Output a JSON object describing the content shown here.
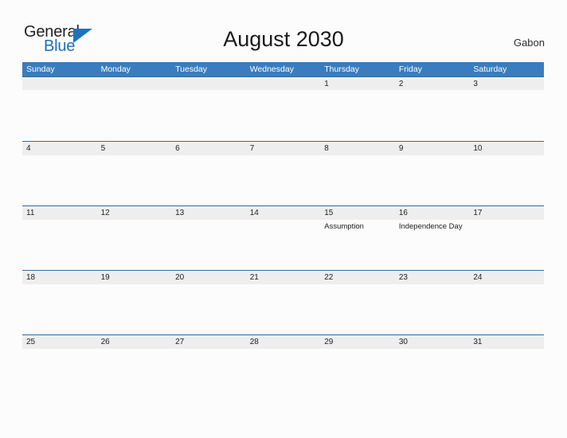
{
  "brand": {
    "name_part1": "General",
    "name_part2": "Blue",
    "triangle_color": "#2072b8"
  },
  "header": {
    "title": "August 2030",
    "country": "Gabon"
  },
  "colors": {
    "header_blue": "#3a7cbd",
    "row_divider_blue": "#2e6da4",
    "date_band_gray": "#eeeeee",
    "page_background": "#fcfcfc",
    "brand_blue": "#1e6fbd"
  },
  "calendar": {
    "month": "August",
    "year": "2030",
    "weekdays": [
      "Sunday",
      "Monday",
      "Tuesday",
      "Wednesday",
      "Thursday",
      "Friday",
      "Saturday"
    ],
    "weeks": [
      {
        "days": [
          {
            "date": "",
            "event": ""
          },
          {
            "date": "",
            "event": ""
          },
          {
            "date": "",
            "event": ""
          },
          {
            "date": "",
            "event": ""
          },
          {
            "date": "1",
            "event": ""
          },
          {
            "date": "2",
            "event": ""
          },
          {
            "date": "3",
            "event": ""
          }
        ]
      },
      {
        "days": [
          {
            "date": "4",
            "event": ""
          },
          {
            "date": "5",
            "event": ""
          },
          {
            "date": "6",
            "event": ""
          },
          {
            "date": "7",
            "event": ""
          },
          {
            "date": "8",
            "event": ""
          },
          {
            "date": "9",
            "event": ""
          },
          {
            "date": "10",
            "event": ""
          }
        ]
      },
      {
        "days": [
          {
            "date": "11",
            "event": ""
          },
          {
            "date": "12",
            "event": ""
          },
          {
            "date": "13",
            "event": ""
          },
          {
            "date": "14",
            "event": ""
          },
          {
            "date": "15",
            "event": "Assumption"
          },
          {
            "date": "16",
            "event": "Independence Day"
          },
          {
            "date": "17",
            "event": ""
          }
        ]
      },
      {
        "days": [
          {
            "date": "18",
            "event": ""
          },
          {
            "date": "19",
            "event": ""
          },
          {
            "date": "20",
            "event": ""
          },
          {
            "date": "21",
            "event": ""
          },
          {
            "date": "22",
            "event": ""
          },
          {
            "date": "23",
            "event": ""
          },
          {
            "date": "24",
            "event": ""
          }
        ]
      },
      {
        "days": [
          {
            "date": "25",
            "event": ""
          },
          {
            "date": "26",
            "event": ""
          },
          {
            "date": "27",
            "event": ""
          },
          {
            "date": "28",
            "event": ""
          },
          {
            "date": "29",
            "event": ""
          },
          {
            "date": "30",
            "event": ""
          },
          {
            "date": "31",
            "event": ""
          }
        ]
      }
    ]
  }
}
